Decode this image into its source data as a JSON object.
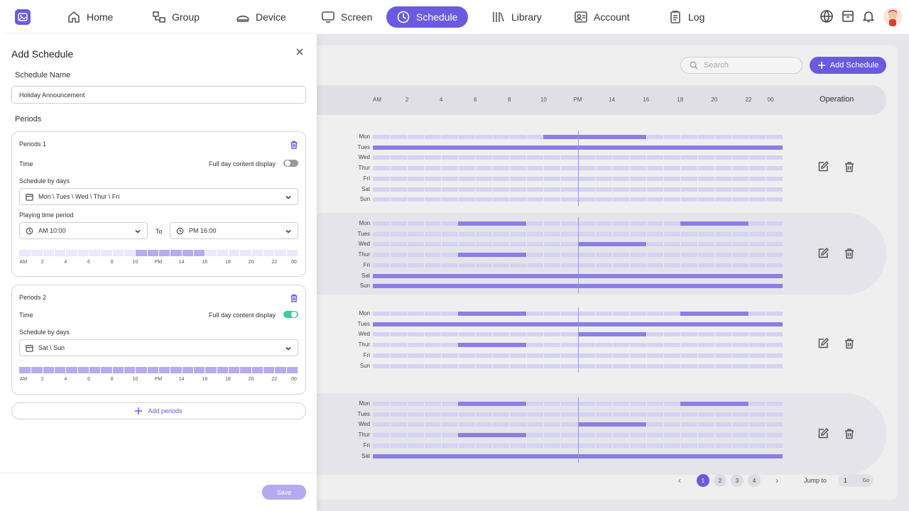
{
  "nav": {
    "items": [
      {
        "label": "Home",
        "icon": "home-icon",
        "active": false
      },
      {
        "label": "Group",
        "icon": "group-icon",
        "active": false
      },
      {
        "label": "Device",
        "icon": "device-icon",
        "active": false
      },
      {
        "label": "Screen",
        "icon": "screen-icon",
        "active": false
      },
      {
        "label": "Schedule",
        "icon": "clock-icon",
        "active": true
      },
      {
        "label": "Library",
        "icon": "library-icon",
        "active": false
      },
      {
        "label": "Account",
        "icon": "account-icon",
        "active": false
      },
      {
        "label": "Log",
        "icon": "log-icon",
        "active": false
      }
    ],
    "accent": "#6a5ae0"
  },
  "main": {
    "search_placeholder": "Search",
    "add_button_label": "Add Schedule",
    "hour_labels": [
      "AM",
      "2",
      "4",
      "6",
      "8",
      "10",
      "PM",
      "14",
      "16",
      "18",
      "20",
      "22",
      "00"
    ],
    "operation_header": "Operation",
    "rows": [
      {
        "days": [
          {
            "label": "Mon",
            "ranges": [
              [
                10,
                16
              ]
            ]
          },
          {
            "label": "Tues",
            "ranges": [
              [
                0,
                24
              ]
            ]
          },
          {
            "label": "Wed",
            "ranges": []
          },
          {
            "label": "Thur",
            "ranges": []
          },
          {
            "label": "Fri",
            "ranges": []
          },
          {
            "label": "Sat",
            "ranges": []
          },
          {
            "label": "Sun",
            "ranges": []
          }
        ]
      },
      {
        "days": [
          {
            "label": "Mon",
            "ranges": [
              [
                5,
                9
              ],
              [
                18,
                22
              ]
            ]
          },
          {
            "label": "Tues",
            "ranges": []
          },
          {
            "label": "Wed",
            "ranges": [
              [
                12,
                16
              ]
            ]
          },
          {
            "label": "Thur",
            "ranges": [
              [
                5,
                9
              ]
            ]
          },
          {
            "label": "Fri",
            "ranges": []
          },
          {
            "label": "Sat",
            "ranges": [
              [
                0,
                24
              ]
            ]
          },
          {
            "label": "Sun",
            "ranges": [
              [
                0,
                24
              ]
            ]
          }
        ]
      },
      {
        "days": [
          {
            "label": "Mon",
            "ranges": [
              [
                5,
                9
              ],
              [
                18,
                22
              ]
            ]
          },
          {
            "label": "Tues",
            "ranges": [
              [
                0,
                24
              ]
            ]
          },
          {
            "label": "Wed",
            "ranges": [
              [
                12,
                16
              ]
            ]
          },
          {
            "label": "Thur",
            "ranges": [
              [
                5,
                9
              ]
            ]
          },
          {
            "label": "Fri",
            "ranges": []
          },
          {
            "label": "Sun",
            "ranges": []
          }
        ]
      },
      {
        "days": [
          {
            "label": "Mon",
            "ranges": [
              [
                5,
                9
              ],
              [
                18,
                22
              ]
            ]
          },
          {
            "label": "Tues",
            "ranges": []
          },
          {
            "label": "Wed",
            "ranges": [
              [
                12,
                16
              ]
            ]
          },
          {
            "label": "Thur",
            "ranges": [
              [
                5,
                9
              ]
            ]
          },
          {
            "label": "Fri",
            "ranges": []
          },
          {
            "label": "Sat",
            "ranges": [
              [
                0,
                24
              ]
            ]
          }
        ]
      }
    ],
    "pagination": {
      "pages": [
        "1",
        "2",
        "3",
        "4"
      ],
      "current": "1",
      "jump_label": "Jump to",
      "jump_value": "1",
      "go_label": "Go"
    }
  },
  "drawer": {
    "title": "Add Schedule",
    "name_label": "Schedule Name",
    "name_value": "Holiday Announcement",
    "periods_label": "Periods",
    "periods": [
      {
        "title": "Periods 1",
        "time_label": "Time",
        "full_day_label": "Full day content display",
        "full_day_on": false,
        "days_label": "Schedule by days",
        "days_value": "Mon \\ Tues \\ Wed \\ Thur \\ Fri",
        "playing_label": "Playing time period",
        "from_value": "AM 10:00",
        "to_label": "To",
        "to_value": "PM 16:00",
        "range": [
          10,
          16
        ]
      },
      {
        "title": "Periods 2",
        "time_label": "Time",
        "full_day_label": "Full day content display",
        "full_day_on": true,
        "days_label": "Schedule by days",
        "days_value": "Sat \\ Sun",
        "range": [
          0,
          24
        ]
      }
    ],
    "mini_labels": [
      "AM",
      "2",
      "4",
      "6",
      "8",
      "10",
      "PM",
      "14",
      "16",
      "18",
      "20",
      "22",
      "00"
    ],
    "add_periods_label": "Add periods",
    "save_label": "Save"
  }
}
